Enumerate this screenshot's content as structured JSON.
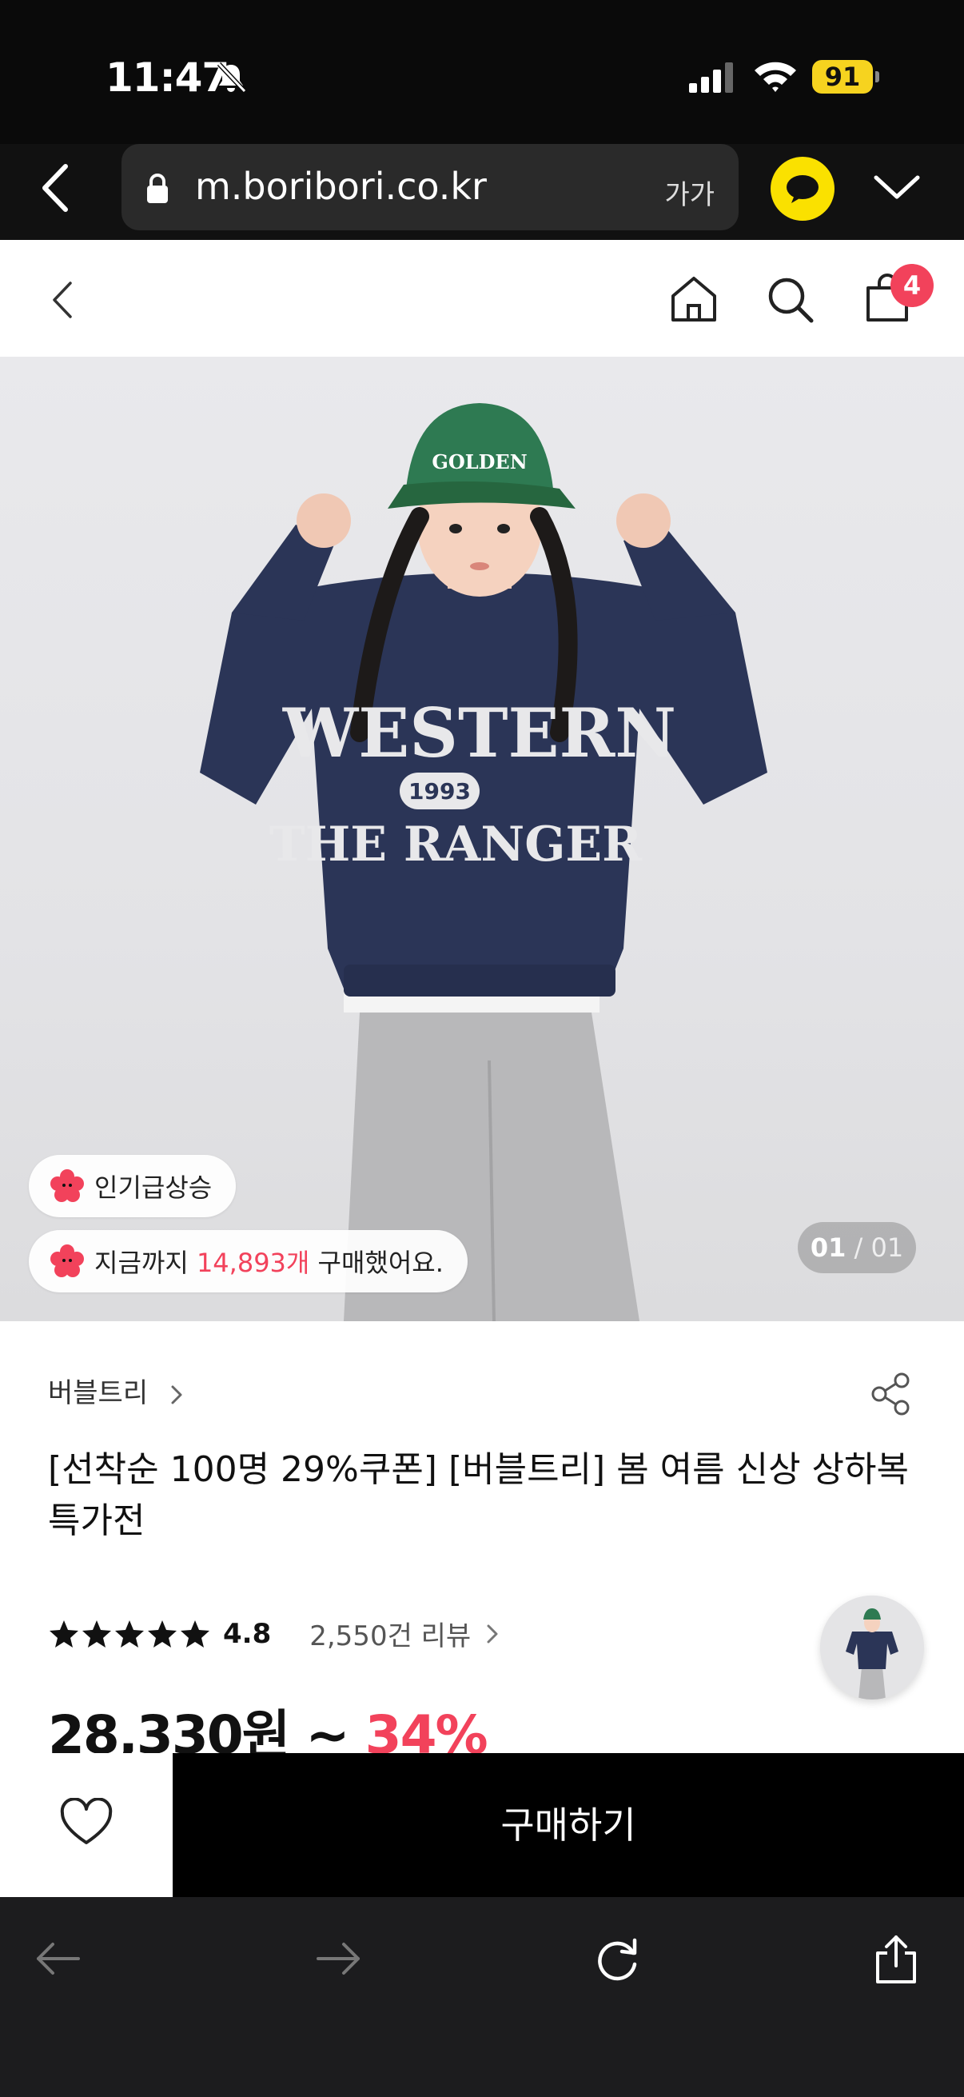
{
  "status_bar": {
    "time": "11:47",
    "battery": "91"
  },
  "browser": {
    "url": "m.boribori.co.kr",
    "text_size_label": "가가"
  },
  "header": {
    "cart_count": "4"
  },
  "hero": {
    "badge_trending": "인기급상승",
    "purchase_prefix": "지금까지 ",
    "purchase_count": "14,893개",
    "purchase_suffix": " 구매했어요.",
    "page_current": "01",
    "page_separator": " / ",
    "page_total": "01"
  },
  "product": {
    "brand": "버블트리",
    "title": "[선착순 100명 29%쿠폰] [버블트리] 봄 여름 신상 상하복 특가전",
    "rating_value": 4.8,
    "rating_score": "4.8",
    "reviews": "2,550건 리뷰",
    "price": "28,330원 ~",
    "discount": "34%"
  },
  "actions": {
    "buy_label": "구매하기"
  },
  "icons": {
    "status": [
      "bell-slash-icon",
      "signal-icon",
      "wifi-icon",
      "battery-icon"
    ],
    "browser": [
      "back-icon",
      "lock-icon",
      "kakao-talk-icon",
      "chevron-down-icon"
    ],
    "header": [
      "back-icon",
      "home-icon",
      "search-icon",
      "shopping-bag-icon"
    ],
    "toolbar": [
      "back-arrow-icon",
      "forward-arrow-icon",
      "reload-icon",
      "share-icon"
    ]
  },
  "colors": {
    "accent": "#f2425b",
    "kakao": "#fae100",
    "battery": "#f6d31f",
    "buy_bg": "#000000"
  }
}
